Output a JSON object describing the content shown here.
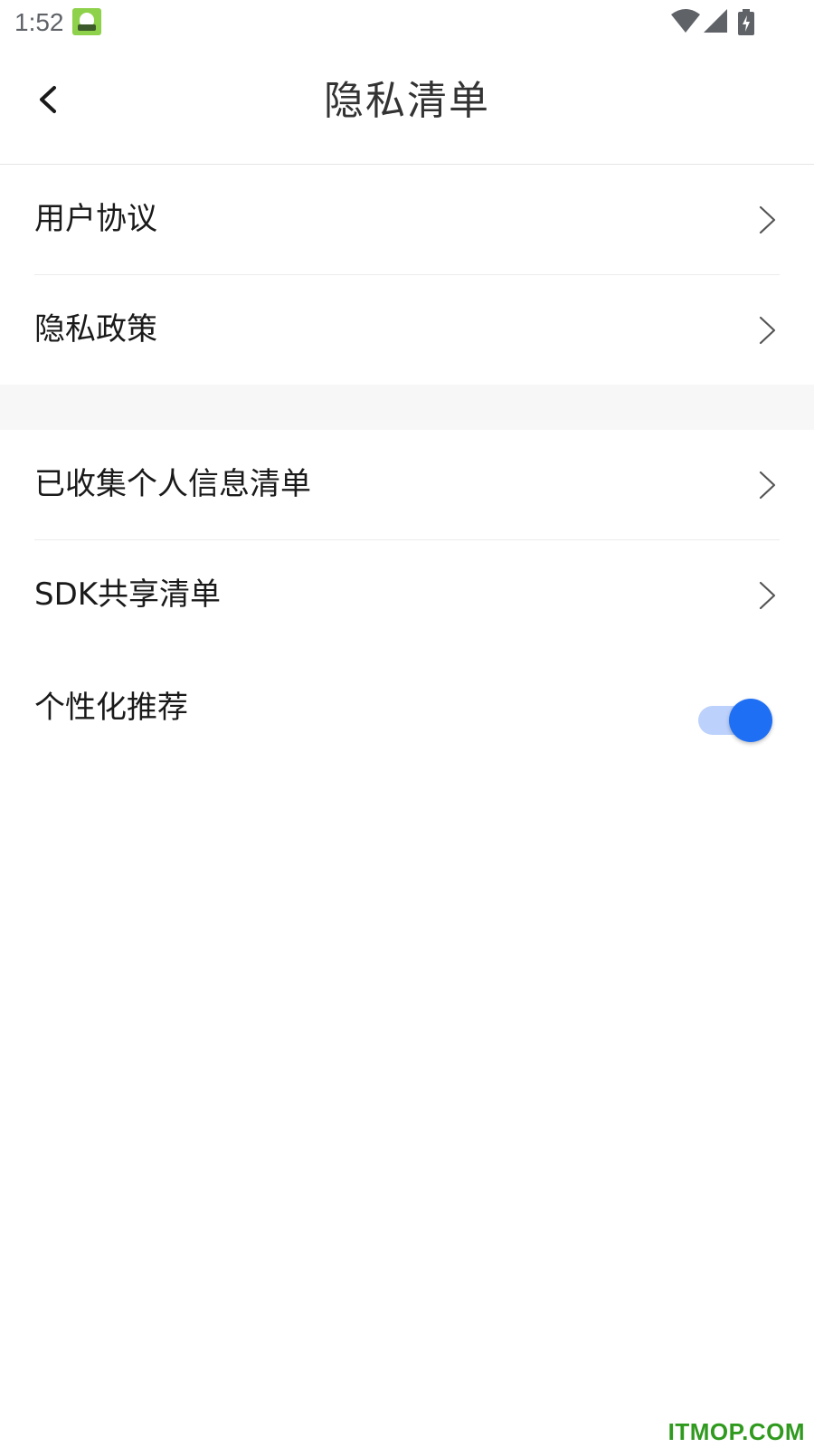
{
  "status_bar": {
    "time": "1:52",
    "icons": [
      "app-notification-icon",
      "wifi-icon",
      "signal-icon",
      "battery-charging-icon"
    ]
  },
  "header": {
    "back_icon": "chevron-left-icon",
    "title": "隐私清单"
  },
  "sections": [
    {
      "items": [
        {
          "label": "用户协议",
          "icon": "chevron-right-icon"
        },
        {
          "label": "隐私政策",
          "icon": "chevron-right-icon"
        }
      ]
    },
    {
      "items": [
        {
          "label": "已收集个人信息清单",
          "icon": "chevron-right-icon"
        },
        {
          "label": "SDK共享清单",
          "icon": "chevron-right-icon"
        }
      ]
    }
  ],
  "personalization": {
    "label": "个性化推荐",
    "enabled": true
  },
  "colors": {
    "accent": "#1f6ff5",
    "toggle_track": "#bcd1fb",
    "watermark": "#2f9a1e"
  },
  "watermark": "ITMOP.COM"
}
